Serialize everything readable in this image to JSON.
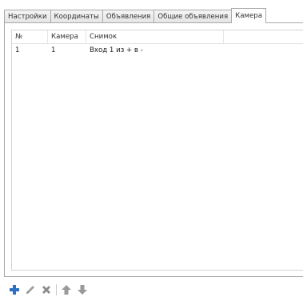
{
  "tabs": [
    {
      "label": "Настройки"
    },
    {
      "label": "Координаты"
    },
    {
      "label": "Объявления"
    },
    {
      "label": "Общие объявления"
    },
    {
      "label": "Камера"
    }
  ],
  "table": {
    "columns": [
      "№",
      "Камера",
      "Снимок"
    ],
    "rows": [
      [
        "1",
        "1",
        "Вход 1 из + в -"
      ]
    ]
  },
  "toolbar": {
    "buttons": [
      {
        "icon": "plus-icon",
        "color": "#2d6fc3"
      },
      {
        "icon": "pencil-icon",
        "color": "#9a9a9a"
      },
      {
        "icon": "delete-icon",
        "color": "#8c8c8c"
      },
      {
        "icon": "arrow-up-icon",
        "color": "#9a9a9a"
      },
      {
        "icon": "arrow-down-icon",
        "color": "#9a9a9a"
      }
    ]
  }
}
